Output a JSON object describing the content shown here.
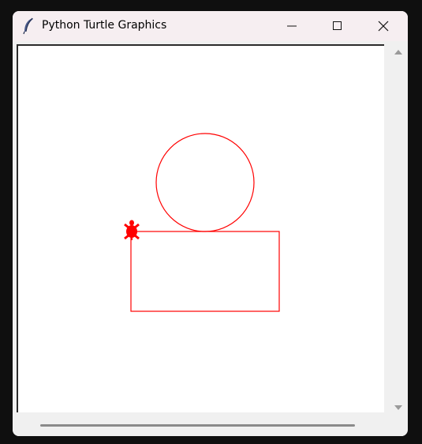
{
  "window": {
    "title": "Python Turtle Graphics"
  },
  "titlebar": {
    "app_icon": "feather-icon",
    "minimize_icon": "minimize-icon",
    "maximize_icon": "maximize-icon",
    "close_icon": "close-icon"
  },
  "canvas": {
    "background": "#ffffff",
    "pen_color": "#ff0000",
    "shapes": [
      "circle",
      "rectangle"
    ],
    "turtle_icon": "turtle-icon"
  },
  "scrollbars": {
    "up_arrow_icon": "scroll-up-icon",
    "down_arrow_icon": "scroll-down-icon"
  }
}
